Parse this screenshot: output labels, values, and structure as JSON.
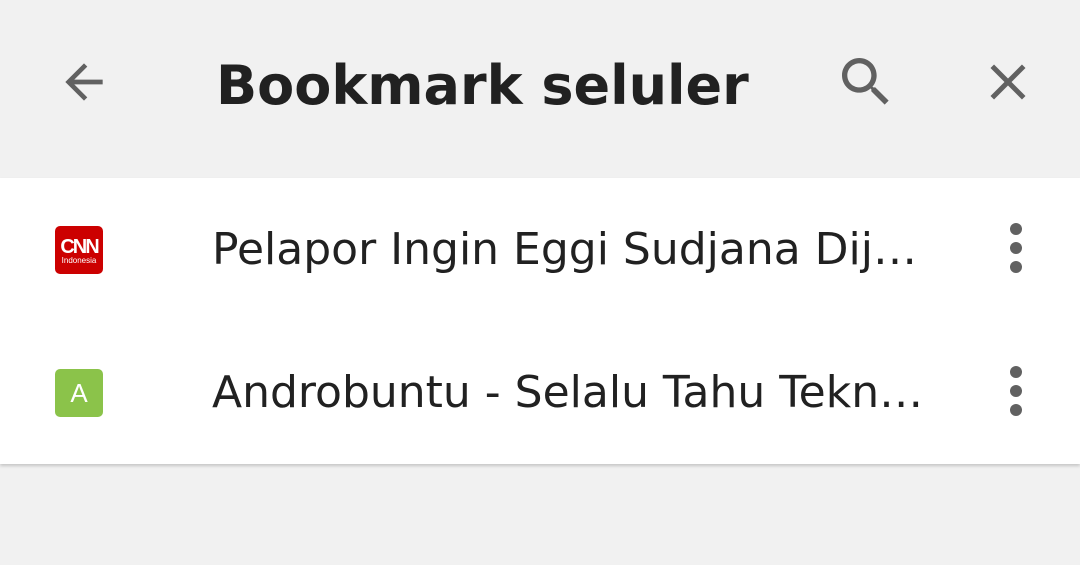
{
  "header": {
    "title": "Bookmark seluler",
    "back_icon": "arrow-back-icon",
    "search_icon": "search-icon",
    "close_icon": "close-icon",
    "icon_color": "#616161"
  },
  "bookmarks": [
    {
      "label": "Pelapor Ingin Eggi Sudjana Dijera…",
      "favicon": {
        "type": "cnn-indonesia-logo",
        "text_main": "CNN",
        "text_sub": "Indonesia",
        "color": "#cc0000"
      },
      "menu_icon": "more-vert-icon"
    },
    {
      "label": "Androbuntu - Selalu Tahu Teknol…",
      "favicon": {
        "type": "letter",
        "letter": "A",
        "color": "#8bc34a"
      },
      "menu_icon": "more-vert-icon"
    }
  ]
}
